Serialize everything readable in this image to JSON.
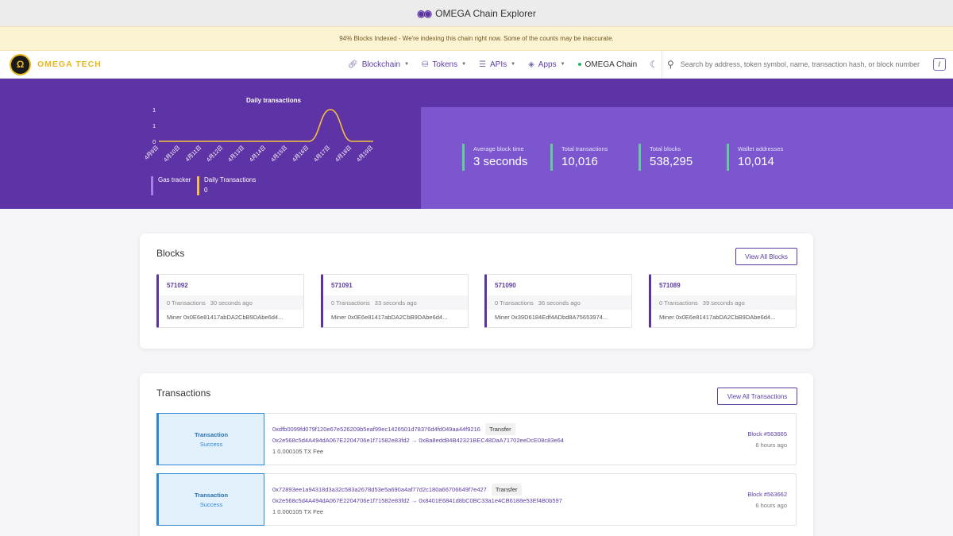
{
  "window": {
    "title": "OMEGA Chain Explorer"
  },
  "banner": {
    "text": "94% Blocks Indexed - We're indexing this chain right now. Some of the counts may be inaccurate."
  },
  "brand": {
    "name": "OMEGA TECH",
    "logo_glyph": "Ω"
  },
  "nav": {
    "items": [
      {
        "label": "Blockchain",
        "icon": "link-icon"
      },
      {
        "label": "Tokens",
        "icon": "coins-icon"
      },
      {
        "label": "APIs",
        "icon": "sliders-icon"
      },
      {
        "label": "Apps",
        "icon": "layers-icon"
      }
    ],
    "chain_label": "OMEGA Chain",
    "search_placeholder": "Search by address, token symbol, name, transaction hash, or block number",
    "search_shortcut": "/"
  },
  "hero": {
    "legend": {
      "gas_label": "Gas tracker",
      "daily_label": "Daily Transactions",
      "daily_value": "0"
    },
    "stats": [
      {
        "label": "Average block time",
        "value": "3 seconds"
      },
      {
        "label": "Total transactions",
        "value": "10,016"
      },
      {
        "label": "Total blocks",
        "value": "538,295"
      },
      {
        "label": "Wallet addresses",
        "value": "10,014"
      }
    ]
  },
  "chart_data": {
    "type": "line",
    "title": "Daily transactions",
    "categories": [
      "4月9日",
      "4月10日",
      "4月11日",
      "4月12日",
      "4月13日",
      "4月14日",
      "4月15日",
      "4月16日",
      "4月17日",
      "4月18日",
      "4月19日"
    ],
    "y_ticks": [
      "0",
      "1",
      "1"
    ],
    "ylim": [
      0,
      2
    ],
    "series": [
      {
        "values": [
          0,
          0,
          0,
          0,
          0,
          0,
          0,
          0,
          2,
          0,
          0
        ],
        "color": "#f5c13a"
      }
    ],
    "grid": false
  },
  "blocks": {
    "title": "Blocks",
    "view_all": "View All Blocks",
    "items": [
      {
        "number": "571092",
        "tx_count": "0 Transactions",
        "age": "30 seconds ago",
        "miner": "Miner 0x0E6e81417abDA2CbB9DAbe6d4..."
      },
      {
        "number": "571091",
        "tx_count": "0 Transactions",
        "age": "33 seconds ago",
        "miner": "Miner 0x0E6e81417abDA2CbB9DAbe6d4..."
      },
      {
        "number": "571090",
        "tx_count": "0 Transactions",
        "age": "36 seconds ago",
        "miner": "Miner 0x39D6184Edf4ADbd8A75653974..."
      },
      {
        "number": "571089",
        "tx_count": "0 Transactions",
        "age": "39 seconds ago",
        "miner": "Miner 0x0E6e81417abDA2CbB9DAbe6d4..."
      }
    ]
  },
  "transactions": {
    "title": "Transactions",
    "view_all": "View All Transactions",
    "items": [
      {
        "status_type": "Transaction",
        "status": "Success",
        "hash": "0xdfb0099fd079f120e67e526209b5eaf99ec1426501d78376d4fd049aa44f9216",
        "tag": "Transfer",
        "from_to": "0x2e568c5d4A494dA067E2204706e1f71582e83fd2 → 0xBa8edd84B42321BEC48DaA71702eeDcE08c83e64",
        "value": "1",
        "fee": "0.000105 TX Fee",
        "block": "Block #563665",
        "age": "6 hours ago"
      },
      {
        "status_type": "Transaction",
        "status": "Success",
        "hash": "0x72893ee1a94318d3a32c583a2678d53e5a690a4af77d2c180a66706649f7e427",
        "tag": "Transfer",
        "from_to": "0x2e568c5d4A494dA067E2204706e1f71582e83fd2 → 0x8401E6841d8bC0BC33a1e4CB6188e53Ef4B0b597",
        "value": "1",
        "fee": "0.000105 TX Fee",
        "block": "Block #563662",
        "age": "6 hours ago"
      }
    ]
  }
}
